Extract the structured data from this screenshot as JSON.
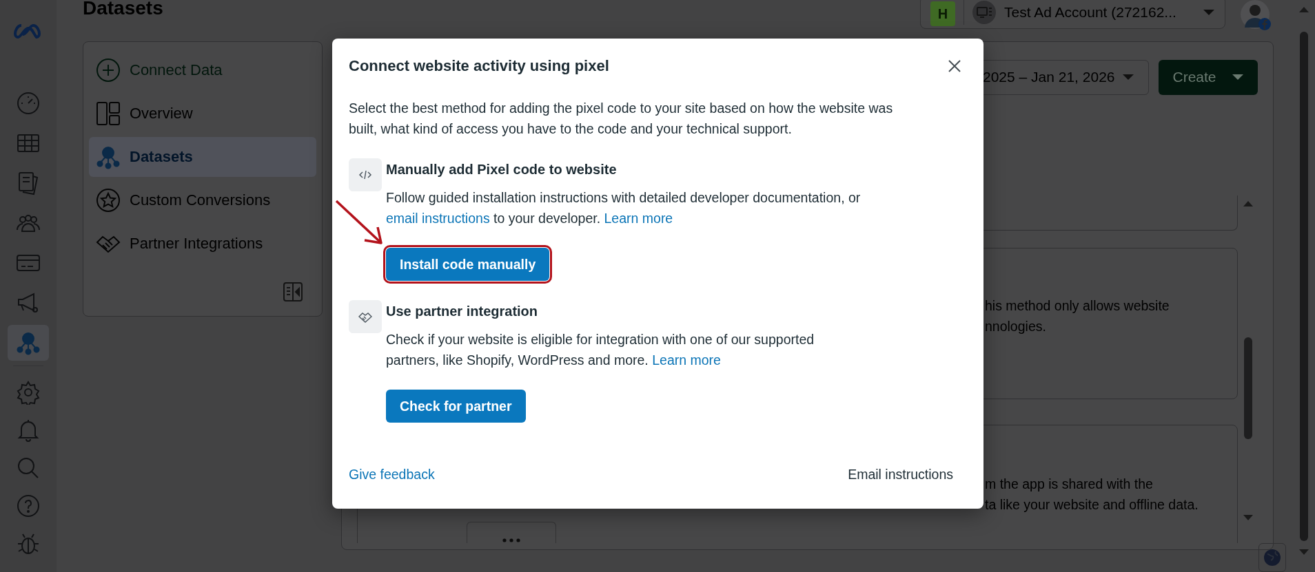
{
  "rail": {
    "items": [
      {
        "selected": false
      },
      {
        "selected": false
      },
      {
        "selected": false
      },
      {
        "selected": false
      },
      {
        "selected": false
      },
      {
        "selected": false
      },
      {
        "selected": true
      }
    ],
    "bottom_items": [
      {
        "selected": false
      },
      {
        "selected": false
      },
      {
        "selected": false
      },
      {
        "selected": false
      },
      {
        "selected": false
      }
    ]
  },
  "page_title": "Datasets",
  "account": {
    "badge": "H",
    "name": "Test Ad Account (272162..."
  },
  "nav": {
    "items": [
      {
        "label": "Connect Data",
        "kind": "action",
        "selected": false
      },
      {
        "label": "Overview",
        "kind": "page",
        "selected": false
      },
      {
        "label": "Datasets",
        "kind": "page",
        "selected": true
      },
      {
        "label": "Custom Conversions",
        "kind": "page",
        "selected": false
      },
      {
        "label": "Partner Integrations",
        "kind": "page",
        "selected": false
      }
    ]
  },
  "toolbar": {
    "date_range": "2025 – Jan 21, 2026",
    "create_button": "Create"
  },
  "background_cards": [
    {
      "lines": [
        "his method only allows website",
        "nnologies."
      ]
    },
    {
      "lines": [
        "m the app is shared with the",
        "ta like your website and offline data."
      ]
    }
  ],
  "modal": {
    "title": "Connect website activity using pixel",
    "description": "Select the best method for adding the pixel code to your site based on how the website was built, what kind of access you have to the code and your technical support.",
    "sections": [
      {
        "title": "Manually add Pixel code to website",
        "body": [
          {
            "kind": "text",
            "text": "Follow guided installation instructions with detailed developer documentation, or "
          },
          {
            "kind": "link",
            "text": "email instructions"
          },
          {
            "kind": "text",
            "text": " to your developer. "
          },
          {
            "kind": "link",
            "text": "Learn more"
          }
        ],
        "button": {
          "label": "Install code manually",
          "highlighted": true
        }
      },
      {
        "title": "Use partner integration",
        "body": [
          {
            "kind": "text",
            "text": "Check if your website is eligible for integration with one of our supported partners, like Shopify, WordPress and more. "
          },
          {
            "kind": "link",
            "text": "Learn more"
          }
        ],
        "button": {
          "label": "Check for partner",
          "highlighted": false
        }
      }
    ],
    "footer": {
      "feedback_link": "Give feedback",
      "email_button": "Email instructions"
    }
  }
}
